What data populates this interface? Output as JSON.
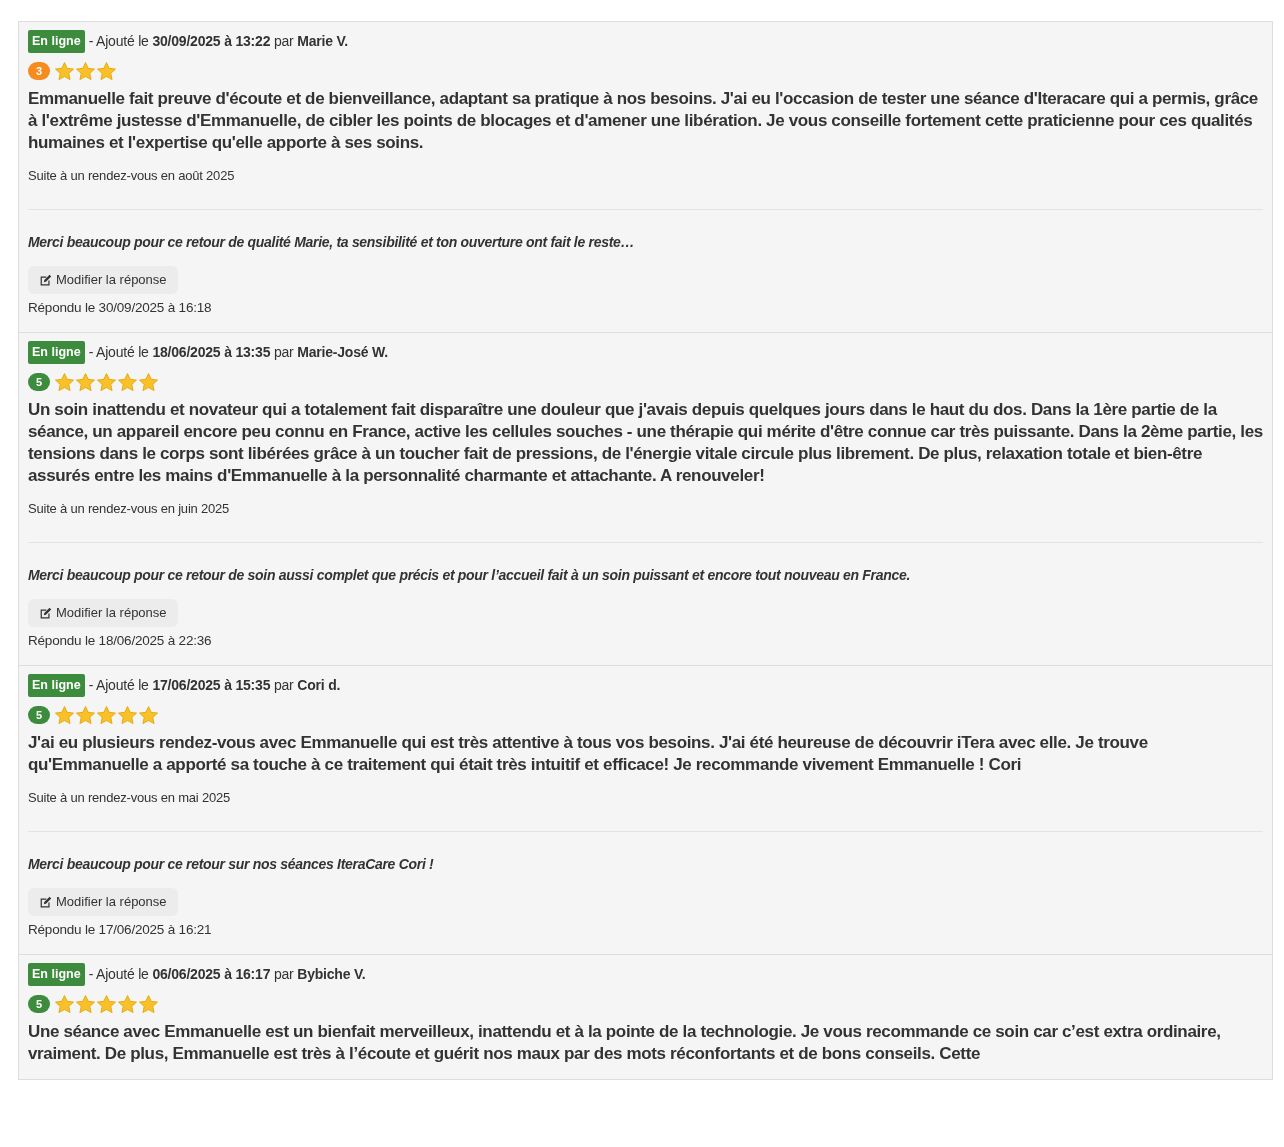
{
  "reviews": [
    {
      "status": "En ligne",
      "meta": "- Ajouté le **30/09/2025 à 13:22** par **Marie V.**",
      "rating": "3",
      "color": "#f68b1f",
      "stars": 3,
      "text": "Emmanuelle fait preuve d'écoute et de bienveillance, adaptant sa pratique à nos besoins. J'ai eu l'occasion de tester une séance d'Iteracare qui a permis, grâce à l'extrême justesse d'Emmanuelle, de cibler les points de blocages et d'amener une libération. Je vous conseille fortement cette praticienne pour ces qualités humaines et l'expertise qu'elle apporte à ses soins.",
      "visit": "Suite à un rendez-vous en août 2025",
      "reply": "Merci beaucoup pour ce retour de qualité Marie, ta sensibilité et ton ouverture ont fait le reste…",
      "edit_button": "Modifier la réponse",
      "replied": "Répondu le 30/09/2025 à 16:18"
    },
    {
      "status": "En ligne",
      "meta": "- Ajouté le **18/06/2025 à 13:35** par **Marie-José W.**",
      "rating": "5",
      "color": "#3d8b3d",
      "stars": 5,
      "text": "Un soin inattendu et novateur qui a totalement fait disparaître une douleur que j'avais depuis quelques jours dans le haut du dos. Dans la 1ère partie de la séance, un appareil encore peu connu en France, active les cellules souches - une thérapie qui mérite d'être connue car très puissante. Dans la 2ème partie, les tensions dans le corps sont libérées grâce à un toucher fait de pressions, de l'énergie vitale circule plus librement. De plus, relaxation totale et bien-être assurés entre les mains d'Emmanuelle à la personnalité charmante et attachante.  A renouveler!",
      "visit": "Suite à un rendez-vous en juin 2025",
      "reply": "Merci beaucoup pour ce retour de soin aussi complet que précis et pour l’accueil fait à un soin puissant et encore tout nouveau en France.",
      "edit_button": "Modifier la réponse",
      "replied": "Répondu le 18/06/2025 à 22:36"
    },
    {
      "status": "En ligne",
      "meta": "- Ajouté le **17/06/2025 à 15:35** par **Cori d.**",
      "rating": "5",
      "color": "#3d8b3d",
      "stars": 5,
      "text": "J'ai eu plusieurs rendez-vous avec Emmanuelle qui est très attentive à tous vos besoins. J'ai été heureuse de découvrir iTera avec elle. Je trouve qu'Emmanuelle a apporté sa touche à ce traitement qui était très intuitif et efficace!  Je recommande vivement Emmanuelle ! Cori",
      "visit": "Suite à un rendez-vous en mai 2025",
      "reply": "Merci beaucoup pour ce retour sur nos séances IteraCare Cori !",
      "edit_button": "Modifier la réponse",
      "replied": "Répondu le 17/06/2025 à 16:21"
    },
    {
      "status": "En ligne",
      "meta": "- Ajouté le **06/06/2025 à 16:17** par **Bybiche V.**",
      "rating": "5",
      "color": "#3d8b3d",
      "stars": 5,
      "text": "Une séance avec Emmanuelle est un bienfait merveilleux, inattendu et à la pointe de la technologie. Je vous recommande ce soin car c’est extra ordinaire, vraiment. De plus, Emmanuelle est très à l’écoute et guérit nos maux par des mots réconfortants et de bons conseils. Cette"
    }
  ]
}
